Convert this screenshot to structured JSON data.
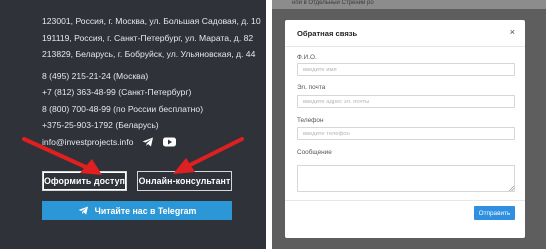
{
  "contacts": {
    "addresses": [
      "123001, Россия, г. Москва, ул. Большая Садовая, д. 10",
      "191119, Россия, г. Санкт-Петербург, ул. Марата, д. 82",
      "213829, Беларусь, г. Бобруйск, ул. Ульяновская, д. 44"
    ],
    "phones": [
      "8 (495) 215-21-24 (Москва)",
      "+7 (812) 363-48-99 (Санкт-Петербург)",
      "8 (800) 700-48-99 (по России бесплатно)",
      "+375-25-903-1792 (Беларусь)"
    ],
    "email": "info@investprojects.info",
    "social_icons": [
      "telegram-icon",
      "youtube-icon"
    ]
  },
  "buttons": {
    "access": "Оформить доступ",
    "online_consultant": "Онлайн-консультант",
    "telegram": "Читайте нас в Telegram"
  },
  "background_text": "нпи в Отдельный Стрении ро",
  "modal": {
    "title": "Обратная связь",
    "close": "×",
    "fields": {
      "name": {
        "label": "Ф.И.О.",
        "placeholder": "введите имя"
      },
      "email": {
        "label": "Эл. почта",
        "placeholder": "введите адрес эл. почты"
      },
      "phone": {
        "label": "Телефон",
        "placeholder": "введите телефон"
      },
      "message": {
        "label": "Сообщение"
      }
    },
    "submit": "Отправить"
  },
  "colors": {
    "panel_bg": "#2f3238",
    "telegram_button": "#2c97d7",
    "submit_button": "#2f8fe0",
    "arrow": "#e02020",
    "overlay": "#5e5e5e"
  }
}
